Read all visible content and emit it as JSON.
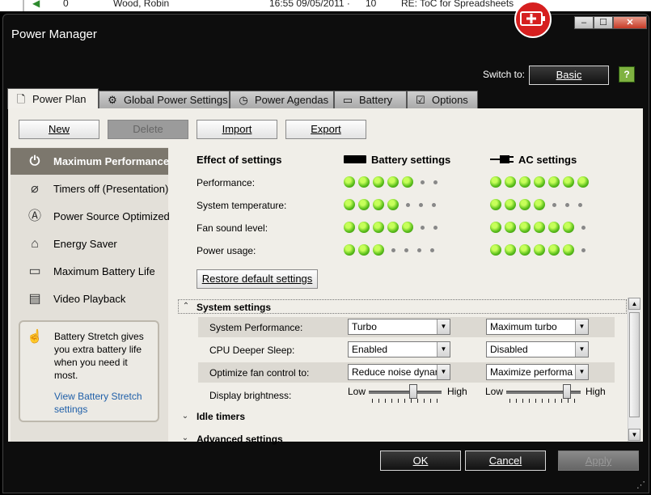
{
  "email_strip": {
    "count": "0",
    "from": "Wood, Robin",
    "date": "16:55 09/05/2011 ·",
    "size": "10",
    "subject": "RE: ToC for Spreadsheets"
  },
  "window": {
    "title": "Power Manager",
    "minimize": "–",
    "maximize": "☐",
    "close": "✕"
  },
  "switch_to": {
    "label": "Switch to:",
    "button": "Basic"
  },
  "tabs": [
    {
      "label": "Power Plan",
      "icon": "document-icon"
    },
    {
      "label": "Global Power Settings",
      "icon": "gear-icon"
    },
    {
      "label": "Power Agendas",
      "icon": "clock-icon"
    },
    {
      "label": "Battery",
      "icon": "battery-icon"
    },
    {
      "label": "Options",
      "icon": "checkbox-icon"
    }
  ],
  "toolbar": {
    "new": "New",
    "delete": "Delete",
    "import": "Import",
    "export": "Export"
  },
  "plans": [
    {
      "label": "Maximum Performance",
      "icon": "power-icon",
      "selected": true
    },
    {
      "label": "Timers off (Presentation)",
      "icon": "projector-icon"
    },
    {
      "label": "Power Source Optimized",
      "icon": "a-circle-icon"
    },
    {
      "label": "Energy Saver",
      "icon": "house-icon"
    },
    {
      "label": "Maximum Battery Life",
      "icon": "battery-clock-icon"
    },
    {
      "label": "Video Playback",
      "icon": "film-icon"
    }
  ],
  "battery_stretch": {
    "text": "Battery Stretch gives you extra battery life when you need it most.",
    "link": "View Battery Stretch settings"
  },
  "effect": {
    "title": "Effect of settings",
    "battery_header": "Battery settings",
    "ac_header": "AC settings",
    "rows": [
      {
        "label": "Performance:",
        "battery": 5,
        "ac": 7
      },
      {
        "label": "System temperature:",
        "battery": 4,
        "ac": 4
      },
      {
        "label": "Fan sound level:",
        "battery": 5,
        "ac": 6
      },
      {
        "label": "Power usage:",
        "battery": 3,
        "ac": 6
      }
    ],
    "scale": 7
  },
  "restore_button": "Restore default settings",
  "system_settings": {
    "title": "System settings",
    "rows": [
      {
        "label": "System Performance:",
        "battery": "Turbo",
        "ac": "Maximum turbo"
      },
      {
        "label": "CPU Deeper Sleep:",
        "battery": "Enabled",
        "ac": "Disabled"
      },
      {
        "label": "Optimize fan control to:",
        "battery": "Reduce noise dynar",
        "ac": "Maximize performa"
      }
    ],
    "brightness": {
      "label": "Display brightness:",
      "low": "Low",
      "high": "High",
      "battery_level": 0.62,
      "ac_level": 0.85
    }
  },
  "sections": {
    "idle": "Idle timers",
    "advanced": "Advanced settings"
  },
  "footer": {
    "ok": "OK",
    "cancel": "Cancel",
    "apply": "Apply"
  }
}
